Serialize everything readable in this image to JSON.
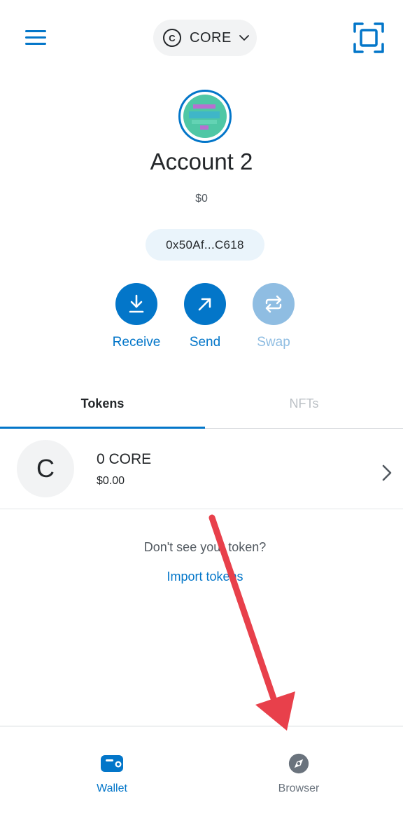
{
  "header": {
    "network_icon_letter": "C",
    "network_label": "CORE",
    "menu_icon": "hamburger-menu-icon",
    "scan_icon": "qr-scan-icon"
  },
  "account": {
    "name": "Account 2",
    "balance": "$0",
    "address": "0x50Af...C618"
  },
  "actions": [
    {
      "label": "Receive",
      "icon": "download-icon",
      "enabled": true
    },
    {
      "label": "Send",
      "icon": "arrow-up-right-icon",
      "enabled": true
    },
    {
      "label": "Swap",
      "icon": "swap-icon",
      "enabled": false
    }
  ],
  "tabs": [
    {
      "label": "Tokens",
      "active": true
    },
    {
      "label": "NFTs",
      "active": false
    }
  ],
  "tokens": [
    {
      "logo_letter": "C",
      "amount": "0 CORE",
      "fiat": "$0.00"
    }
  ],
  "empty_state": {
    "text": "Don't see your token?",
    "link": "Import tokens"
  },
  "bottom_nav": [
    {
      "label": "Wallet",
      "icon": "wallet-icon",
      "active": true
    },
    {
      "label": "Browser",
      "icon": "compass-icon",
      "active": false
    }
  ],
  "colors": {
    "accent": "#0376c9",
    "disabled_accent": "#8fbde2",
    "annotation_arrow": "#e8404b"
  }
}
